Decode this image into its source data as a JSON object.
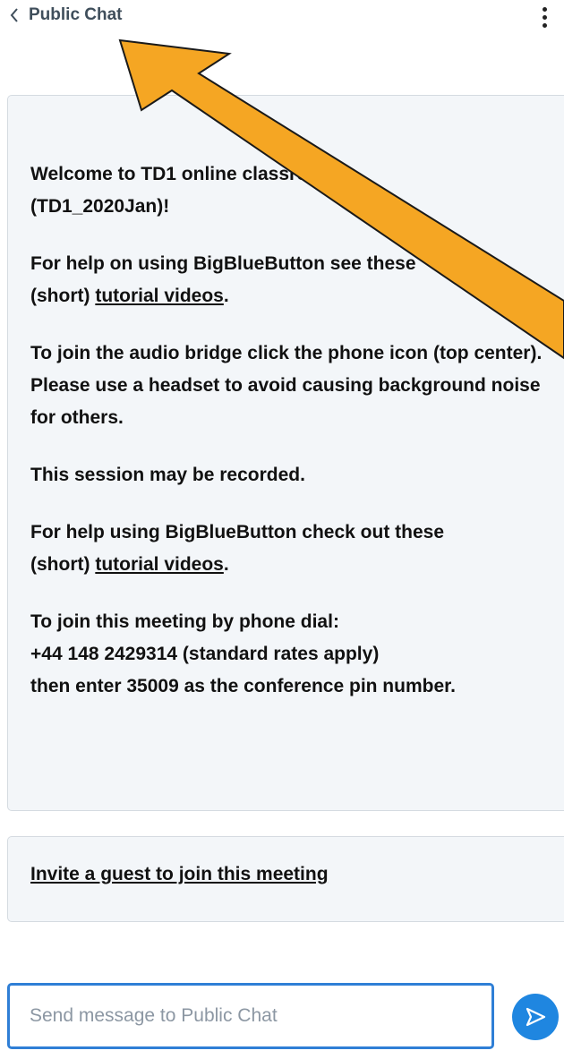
{
  "header": {
    "back_label": "Public Chat",
    "back_icon": "chevron-left-icon",
    "menu_icon": "kebab-menu-icon"
  },
  "welcome": {
    "p1_line1": "Welcome to TD1 online classroom",
    "p1_line2": "(TD1_2020Jan)!",
    "p2_text": "For help on using BigBlueButton see these",
    "p2_prefix": "(short) ",
    "p2_link": "tutorial videos",
    "p2_suffix": ".",
    "p3_normal": "To join the audio bridge click the phone icon (top center).",
    "p3_bold": " Please use a headset to avoid causing background noise for others.",
    "p4": "This session may be recorded.",
    "p5_text": "For help using BigBlueButton check out these",
    "p5_prefix": "(short) ",
    "p5_link": "tutorial videos",
    "p5_suffix": ".",
    "p6_line1": "To join this meeting by phone dial:",
    "p6_line2": "+44 148 2429314 (standard rates apply)",
    "p6_line3": "then enter 35009 as the conference pin number."
  },
  "invite": {
    "link_label": "Invite a guest to join this meeting"
  },
  "composer": {
    "placeholder": "Send message to Public Chat",
    "send_icon": "send-icon"
  },
  "colors": {
    "accent": "#1f86e0",
    "annotation_arrow": "#f5a623",
    "card_background": "#f3f6f9"
  }
}
